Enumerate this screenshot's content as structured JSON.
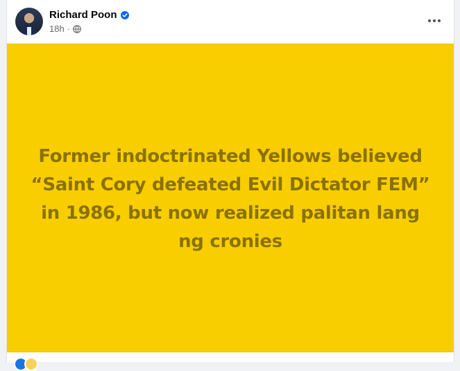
{
  "post": {
    "author": {
      "name": "Richard Poon",
      "verified": true,
      "avatar_icon": "profile-photo"
    },
    "timestamp": "18h",
    "separator": "·",
    "audience_icon": "globe-icon",
    "more_icon": "more-horizontal-icon",
    "status_background_color": "#f8ce00",
    "status_text_color": "#8a7100",
    "status_text": "Former indoctrinated Yellows believed “Saint Cory defeated Evil Dictator FEM” in 1986, but now realized palitan lang ng cronies",
    "reactions": [
      "like-icon",
      "haha-icon"
    ]
  }
}
